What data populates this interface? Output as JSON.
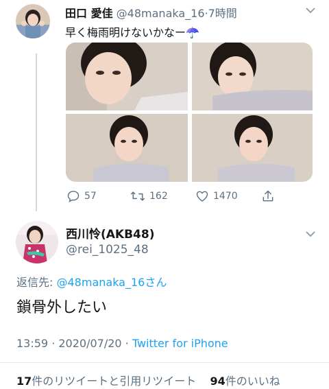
{
  "parent_tweet": {
    "author_name": "田口 愛佳",
    "handle": "@48manaka_16",
    "separator": "·",
    "time": "7時間",
    "text": "早く梅雨明けないかなー☂️",
    "actions": {
      "replies": "57",
      "retweets": "162",
      "likes": "1470"
    }
  },
  "main_tweet": {
    "author_name": "西川怜(AKB48)",
    "handle": "@rei_1025_48",
    "replying_prefix": "返信先:",
    "replying_to": "@48manaka_16さん",
    "text": "鎖骨外したい",
    "timestamp": "13:59 · 2020/07/20 · ",
    "client": "Twitter for iPhone",
    "retweet_count": "17",
    "retweet_label": "件のリツイートと引用リツイート",
    "like_count": "94",
    "like_label": "件のいいね"
  },
  "colors": {
    "link": "#1da1f2",
    "secondary_text": "#5b7083",
    "divider": "#e1e8ed"
  },
  "icons": [
    "chevron-down-icon",
    "reply-icon",
    "retweet-icon",
    "like-icon",
    "share-icon"
  ]
}
